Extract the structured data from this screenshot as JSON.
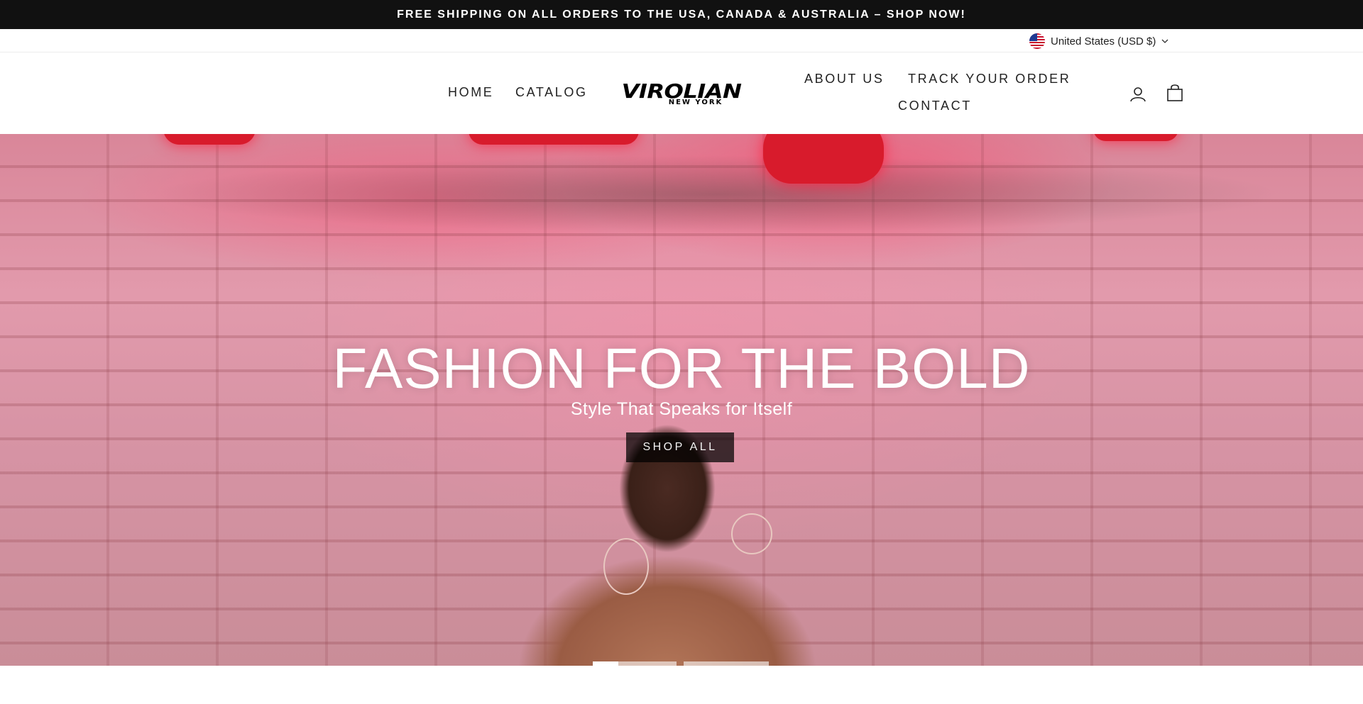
{
  "announcement": {
    "text": "FREE SHIPPING ON ALL ORDERS TO THE USA, CANADA & AUSTRALIA – SHOP NOW!"
  },
  "locale": {
    "label": "United States (USD $)",
    "icon": "us-flag-icon"
  },
  "nav": {
    "home": "HOME",
    "catalog": "CATALOG",
    "about": "ABOUT US",
    "track": "TRACK YOUR ORDER",
    "contact": "CONTACT"
  },
  "logo": {
    "main": "VIROLIAN",
    "sub": "NEW YORK"
  },
  "header_icons": {
    "account": "user-icon",
    "cart": "bag-icon"
  },
  "hero": {
    "title": "FASHION FOR THE BOLD",
    "subtitle": "Style That Speaks for Itself",
    "button": "SHOP ALL"
  },
  "slideshow": {
    "slides": 3,
    "active_index": 0
  },
  "colors": {
    "announcement_bg": "#111111",
    "hero_pink": "#e29aac",
    "neon_red": "#d81b2c"
  }
}
